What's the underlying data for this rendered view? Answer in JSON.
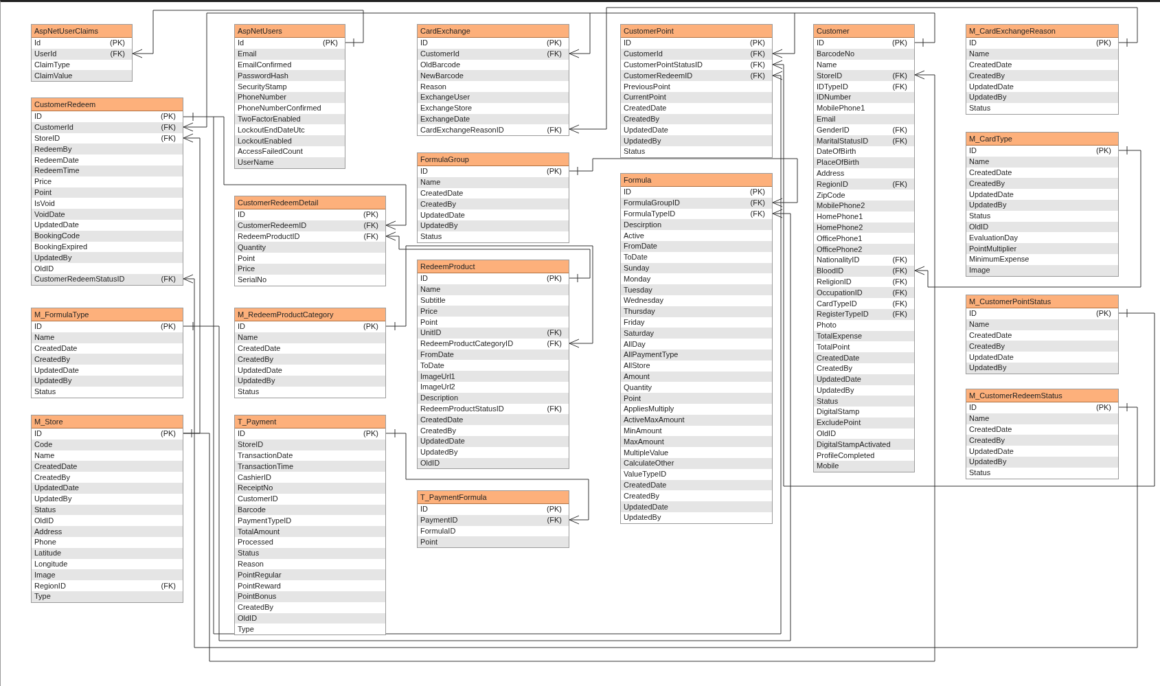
{
  "tables": [
    {
      "name": "AspNetUserClaims",
      "columns": [
        {
          "name": "Id",
          "key": "(PK)"
        },
        {
          "name": "UserId",
          "key": "(FK)"
        },
        {
          "name": "ClaimType"
        },
        {
          "name": "ClaimValue"
        }
      ]
    },
    {
      "name": "AspNetUsers",
      "columns": [
        {
          "name": "Id",
          "key": "(PK)"
        },
        {
          "name": "Email"
        },
        {
          "name": "EmailConfirmed"
        },
        {
          "name": "PasswordHash"
        },
        {
          "name": "SecurityStamp"
        },
        {
          "name": "PhoneNumber"
        },
        {
          "name": "PhoneNumberConfirmed"
        },
        {
          "name": "TwoFactorEnabled"
        },
        {
          "name": "LockoutEndDateUtc"
        },
        {
          "name": "LockoutEnabled"
        },
        {
          "name": "AccessFailedCount"
        },
        {
          "name": "UserName"
        }
      ]
    },
    {
      "name": "CustomerRedeem",
      "columns": [
        {
          "name": "ID",
          "key": "(PK)"
        },
        {
          "name": "CustomerId",
          "key": "(FK)"
        },
        {
          "name": "StoreID",
          "key": "(FK)"
        },
        {
          "name": "RedeemBy"
        },
        {
          "name": "RedeemDate"
        },
        {
          "name": "RedeemTime"
        },
        {
          "name": "Price"
        },
        {
          "name": "Point"
        },
        {
          "name": "IsVoid"
        },
        {
          "name": "VoidDate"
        },
        {
          "name": "UpdatedDate"
        },
        {
          "name": "BookingCode"
        },
        {
          "name": "BookingExpired"
        },
        {
          "name": "UpdatedBy"
        },
        {
          "name": "OldID"
        },
        {
          "name": "CustomerRedeemStatusID",
          "key": "(FK)"
        }
      ]
    },
    {
      "name": "CustomerRedeemDetail",
      "columns": [
        {
          "name": "ID",
          "key": "(PK)"
        },
        {
          "name": "CustomerRedeemID",
          "key": "(FK)"
        },
        {
          "name": "RedeemProductID",
          "key": "(FK)"
        },
        {
          "name": "Quantity"
        },
        {
          "name": "Point"
        },
        {
          "name": "Price"
        },
        {
          "name": "SerialNo"
        }
      ]
    },
    {
      "name": "M_FormulaType",
      "columns": [
        {
          "name": "ID",
          "key": "(PK)"
        },
        {
          "name": "Name"
        },
        {
          "name": "CreatedDate"
        },
        {
          "name": "CreatedBy"
        },
        {
          "name": "UpdatedDate"
        },
        {
          "name": "UpdatedBy"
        },
        {
          "name": "Status"
        }
      ]
    },
    {
      "name": "M_RedeemProductCategory",
      "columns": [
        {
          "name": "ID",
          "key": "(PK)"
        },
        {
          "name": "Name"
        },
        {
          "name": "CreatedDate"
        },
        {
          "name": "CreatedBy"
        },
        {
          "name": "UpdatedDate"
        },
        {
          "name": "UpdatedBy"
        },
        {
          "name": "Status"
        }
      ]
    },
    {
      "name": "M_Store",
      "columns": [
        {
          "name": "ID",
          "key": "(PK)"
        },
        {
          "name": "Code"
        },
        {
          "name": "Name"
        },
        {
          "name": "CreatedDate"
        },
        {
          "name": "CreatedBy"
        },
        {
          "name": "UpdatedDate"
        },
        {
          "name": "UpdatedBy"
        },
        {
          "name": "Status"
        },
        {
          "name": "OldID"
        },
        {
          "name": "Address"
        },
        {
          "name": "Phone"
        },
        {
          "name": "Latitude"
        },
        {
          "name": "Longitude"
        },
        {
          "name": "Image"
        },
        {
          "name": "RegionID",
          "key": "(FK)"
        },
        {
          "name": "Type"
        }
      ]
    },
    {
      "name": "T_Payment",
      "columns": [
        {
          "name": "ID",
          "key": "(PK)"
        },
        {
          "name": "StoreID"
        },
        {
          "name": "TransactionDate"
        },
        {
          "name": "TransactionTime"
        },
        {
          "name": "CashierID"
        },
        {
          "name": "ReceiptNo"
        },
        {
          "name": "CustomerID"
        },
        {
          "name": "Barcode"
        },
        {
          "name": "PaymentTypeID"
        },
        {
          "name": "TotalAmount"
        },
        {
          "name": "Processed"
        },
        {
          "name": "Status"
        },
        {
          "name": "Reason"
        },
        {
          "name": "PointRegular"
        },
        {
          "name": "PointReward"
        },
        {
          "name": "PointBonus"
        },
        {
          "name": "CreatedBy"
        },
        {
          "name": "OldID"
        },
        {
          "name": "Type"
        }
      ]
    },
    {
      "name": "CardExchange",
      "columns": [
        {
          "name": "ID",
          "key": "(PK)"
        },
        {
          "name": "CustomerId",
          "key": "(FK)"
        },
        {
          "name": "OldBarcode"
        },
        {
          "name": "NewBarcode"
        },
        {
          "name": "Reason"
        },
        {
          "name": "ExchangeUser"
        },
        {
          "name": "ExchangeStore"
        },
        {
          "name": "ExchangeDate"
        },
        {
          "name": "CardExchangeReasonID",
          "key": "(FK)"
        }
      ]
    },
    {
      "name": "FormulaGroup",
      "columns": [
        {
          "name": "ID",
          "key": "(PK)"
        },
        {
          "name": "Name"
        },
        {
          "name": "CreatedDate"
        },
        {
          "name": "CreatedBy"
        },
        {
          "name": "UpdatedDate"
        },
        {
          "name": "UpdatedBy"
        },
        {
          "name": "Status"
        }
      ]
    },
    {
      "name": "RedeemProduct",
      "columns": [
        {
          "name": "ID",
          "key": "(PK)"
        },
        {
          "name": "Name"
        },
        {
          "name": "Subtitle"
        },
        {
          "name": "Price"
        },
        {
          "name": "Point"
        },
        {
          "name": "UnitID",
          "key": "(FK)"
        },
        {
          "name": "RedeemProductCategoryID",
          "key": "(FK)"
        },
        {
          "name": "FromDate"
        },
        {
          "name": "ToDate"
        },
        {
          "name": "ImageUrl1"
        },
        {
          "name": "ImageUrl2"
        },
        {
          "name": "Description"
        },
        {
          "name": "RedeemProductStatusID",
          "key": "(FK)"
        },
        {
          "name": "CreatedDate"
        },
        {
          "name": "CreatedBy"
        },
        {
          "name": "UpdatedDate"
        },
        {
          "name": "UpdatedBy"
        },
        {
          "name": "OldID"
        }
      ]
    },
    {
      "name": "T_PaymentFormula",
      "columns": [
        {
          "name": "ID",
          "key": "(PK)"
        },
        {
          "name": "PaymentID",
          "key": "(FK)"
        },
        {
          "name": "FormulaID"
        },
        {
          "name": "Point"
        }
      ]
    },
    {
      "name": "CustomerPoint",
      "columns": [
        {
          "name": "ID",
          "key": "(PK)"
        },
        {
          "name": "CustomerId",
          "key": "(FK)"
        },
        {
          "name": "CustomerPointStatusID",
          "key": "(FK)"
        },
        {
          "name": "CustomerRedeemID",
          "key": "(FK)"
        },
        {
          "name": "PreviousPoint"
        },
        {
          "name": "CurrentPoint"
        },
        {
          "name": "CreatedDate"
        },
        {
          "name": "CreatedBy"
        },
        {
          "name": "UpdatedDate"
        },
        {
          "name": "UpdatedBy"
        },
        {
          "name": "Status"
        }
      ]
    },
    {
      "name": "Formula",
      "columns": [
        {
          "name": "ID",
          "key": "(PK)"
        },
        {
          "name": "FormulaGroupID",
          "key": "(FK)"
        },
        {
          "name": "FormulaTypeID",
          "key": "(FK)"
        },
        {
          "name": "Descirption"
        },
        {
          "name": "Active"
        },
        {
          "name": "FromDate"
        },
        {
          "name": "ToDate"
        },
        {
          "name": "Sunday"
        },
        {
          "name": "Monday"
        },
        {
          "name": "Tuesday"
        },
        {
          "name": "Wednesday"
        },
        {
          "name": "Thursday"
        },
        {
          "name": "Friday"
        },
        {
          "name": "Saturday"
        },
        {
          "name": "AllDay"
        },
        {
          "name": "AllPaymentType"
        },
        {
          "name": "AllStore"
        },
        {
          "name": "Amount"
        },
        {
          "name": "Quantity"
        },
        {
          "name": "Point"
        },
        {
          "name": "AppliesMultiply"
        },
        {
          "name": "ActiveMaxAmount"
        },
        {
          "name": "MinAmount"
        },
        {
          "name": "MaxAmount"
        },
        {
          "name": "MultipleValue"
        },
        {
          "name": "CalculateOther"
        },
        {
          "name": "ValueTypeID"
        },
        {
          "name": "CreatedDate"
        },
        {
          "name": "CreatedBy"
        },
        {
          "name": "UpdatedDate"
        },
        {
          "name": "UpdatedBy"
        }
      ]
    },
    {
      "name": "Customer",
      "columns": [
        {
          "name": "ID",
          "key": "(PK)"
        },
        {
          "name": "BarcodeNo"
        },
        {
          "name": "Name"
        },
        {
          "name": "StoreID",
          "key": "(FK)"
        },
        {
          "name": "IDTypeID",
          "key": "(FK)"
        },
        {
          "name": "IDNumber"
        },
        {
          "name": "MobilePhone1"
        },
        {
          "name": "Email"
        },
        {
          "name": "GenderID",
          "key": "(FK)"
        },
        {
          "name": "MaritalStatusID",
          "key": "(FK)"
        },
        {
          "name": "DateOfBirth"
        },
        {
          "name": "PlaceOfBirth"
        },
        {
          "name": "Address"
        },
        {
          "name": "RegionID",
          "key": "(FK)"
        },
        {
          "name": "ZipCode"
        },
        {
          "name": "MobilePhone2"
        },
        {
          "name": "HomePhone1"
        },
        {
          "name": "HomePhone2"
        },
        {
          "name": "OfficePhone1"
        },
        {
          "name": "OfficePhone2"
        },
        {
          "name": "NationalityID",
          "key": "(FK)"
        },
        {
          "name": "BloodID",
          "key": "(FK)"
        },
        {
          "name": "ReligionID",
          "key": "(FK)"
        },
        {
          "name": "OccupationID",
          "key": "(FK)"
        },
        {
          "name": "CardTypeID",
          "key": "(FK)"
        },
        {
          "name": "RegisterTypeID",
          "key": "(FK)"
        },
        {
          "name": "Photo"
        },
        {
          "name": "TotalExpense"
        },
        {
          "name": "TotalPoint"
        },
        {
          "name": "CreatedDate"
        },
        {
          "name": "CreatedBy"
        },
        {
          "name": "UpdatedDate"
        },
        {
          "name": "UpdatedBy"
        },
        {
          "name": "Status"
        },
        {
          "name": "DigitalStamp"
        },
        {
          "name": "ExcludePoint"
        },
        {
          "name": "OldID"
        },
        {
          "name": "DigitalStampActivated"
        },
        {
          "name": "ProfileCompleted"
        },
        {
          "name": "Mobile"
        }
      ]
    },
    {
      "name": "M_CardExchangeReason",
      "columns": [
        {
          "name": "ID",
          "key": "(PK)"
        },
        {
          "name": "Name"
        },
        {
          "name": "CreatedDate"
        },
        {
          "name": "CreatedBy"
        },
        {
          "name": "UpdatedDate"
        },
        {
          "name": "UpdatedBy"
        },
        {
          "name": "Status"
        }
      ]
    },
    {
      "name": "M_CardType",
      "columns": [
        {
          "name": "ID",
          "key": "(PK)"
        },
        {
          "name": "Name"
        },
        {
          "name": "CreatedDate"
        },
        {
          "name": "CreatedBy"
        },
        {
          "name": "UpdatedDate"
        },
        {
          "name": "UpdatedBy"
        },
        {
          "name": "Status"
        },
        {
          "name": "OldID"
        },
        {
          "name": "EvaluationDay"
        },
        {
          "name": "PointMultiplier"
        },
        {
          "name": "MinimumExpense"
        },
        {
          "name": "Image"
        }
      ]
    },
    {
      "name": "M_CustomerPointStatus",
      "columns": [
        {
          "name": "ID",
          "key": "(PK)"
        },
        {
          "name": "Name"
        },
        {
          "name": "CreatedDate"
        },
        {
          "name": "CreatedBy"
        },
        {
          "name": "UpdatedDate"
        },
        {
          "name": "UpdatedBy"
        }
      ]
    },
    {
      "name": "M_CustomerRedeemStatus",
      "columns": [
        {
          "name": "ID",
          "key": "(PK)"
        },
        {
          "name": "Name"
        },
        {
          "name": "CreatedDate"
        },
        {
          "name": "CreatedBy"
        },
        {
          "name": "UpdatedDate"
        },
        {
          "name": "UpdatedBy"
        },
        {
          "name": "Status"
        }
      ]
    }
  ]
}
